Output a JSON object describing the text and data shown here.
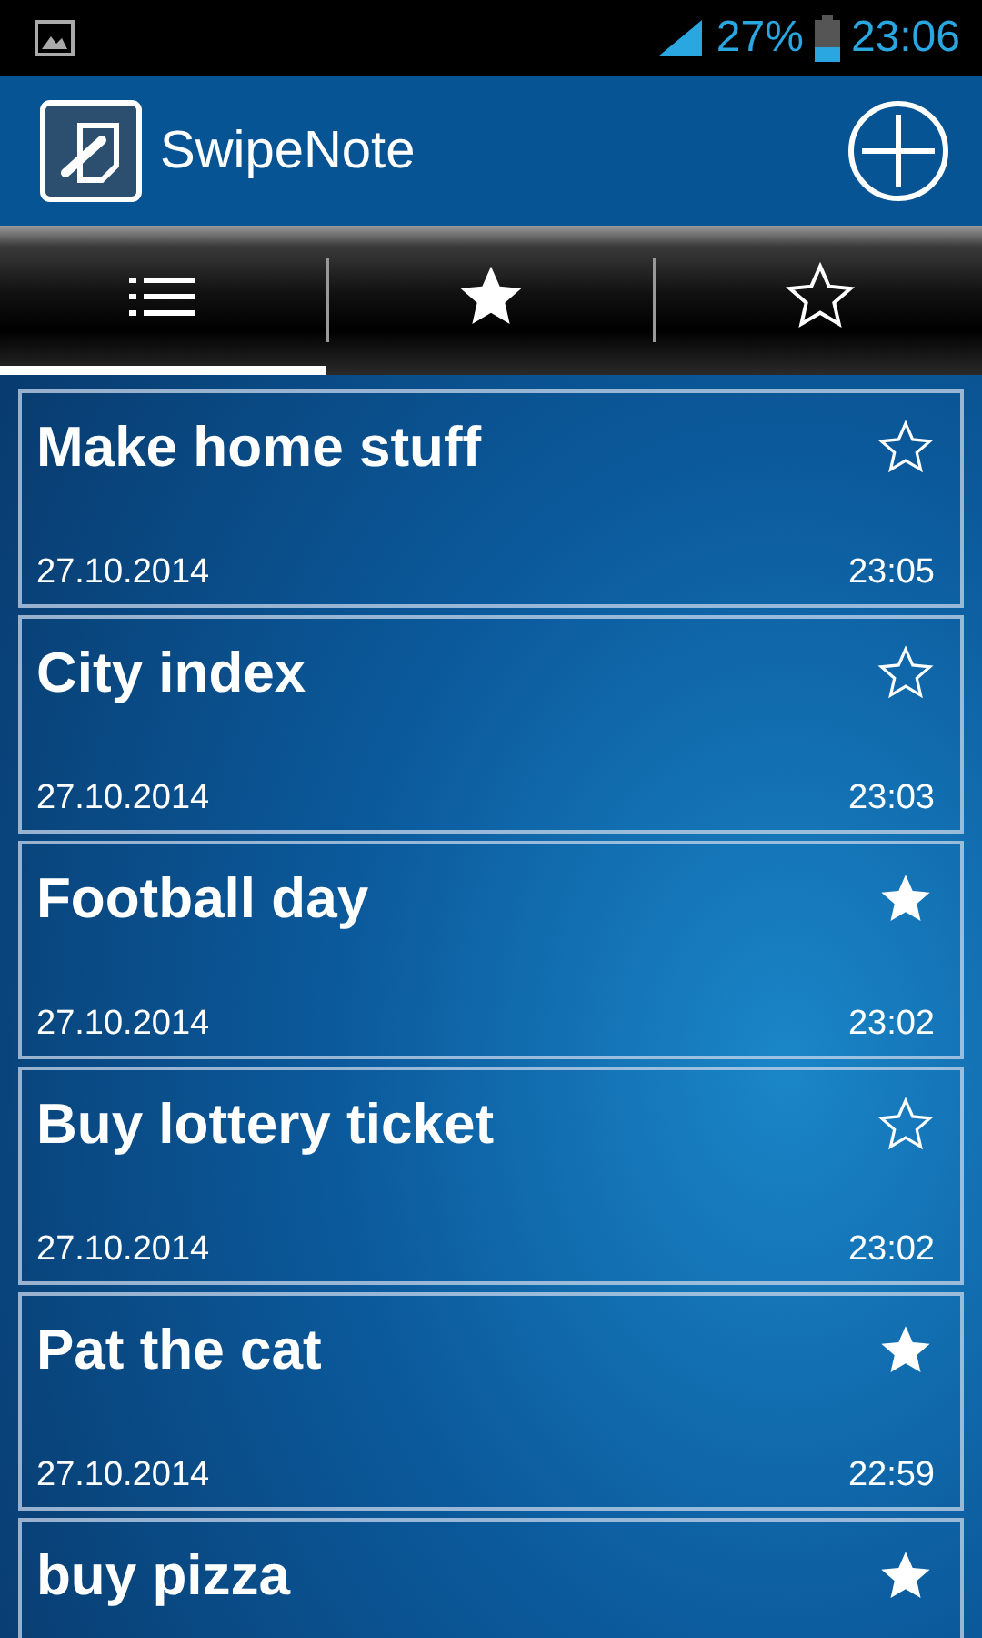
{
  "status_bar": {
    "battery": "27%",
    "time": "23:06"
  },
  "app_bar": {
    "title": "SwipeNote"
  },
  "tabs": [
    {
      "kind": "all",
      "selected": true
    },
    {
      "kind": "starred",
      "selected": false
    },
    {
      "kind": "unstarred",
      "selected": false
    }
  ],
  "notes": [
    {
      "title": "Make home stuff",
      "date": "27.10.2014",
      "time": "23:05",
      "starred": false
    },
    {
      "title": "City index",
      "date": "27.10.2014",
      "time": "23:03",
      "starred": false
    },
    {
      "title": "Football day",
      "date": "27.10.2014",
      "time": "23:02",
      "starred": true
    },
    {
      "title": "Buy lottery ticket",
      "date": "27.10.2014",
      "time": "23:02",
      "starred": false
    },
    {
      "title": "Pat the cat",
      "date": "27.10.2014",
      "time": "22:59",
      "starred": true
    },
    {
      "title": "buy pizza",
      "starred": true
    }
  ]
}
